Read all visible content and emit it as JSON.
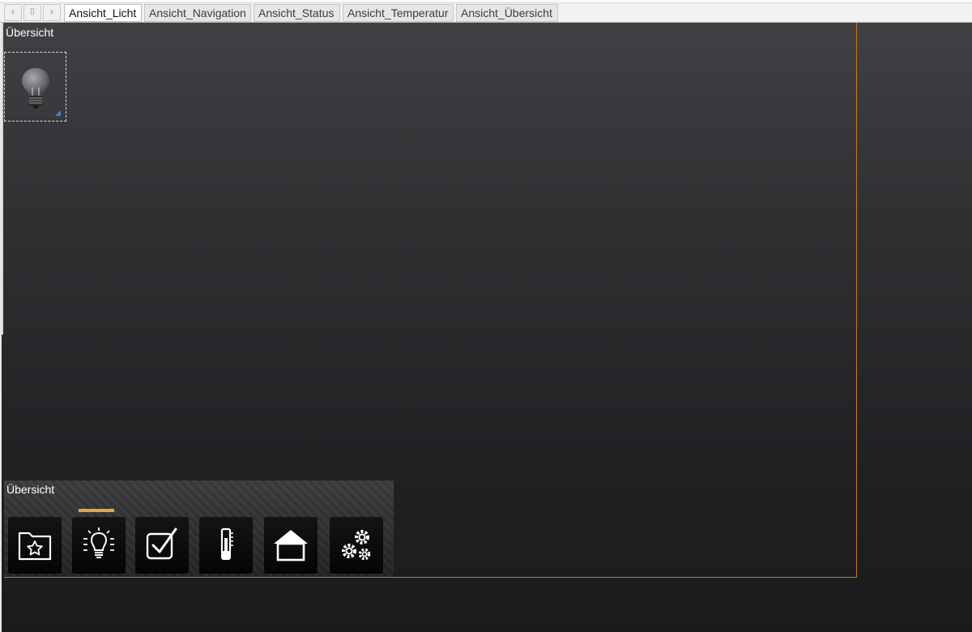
{
  "tabbar": {
    "nav_prev": "‹",
    "nav_menu": "⌷",
    "nav_next": "›",
    "tabs": [
      {
        "label": "Ansicht_Licht",
        "active": true
      },
      {
        "label": "Ansicht_Navigation",
        "active": false
      },
      {
        "label": "Ansicht_Status",
        "active": false
      },
      {
        "label": "Ansicht_Temperatur",
        "active": false
      },
      {
        "label": "Ansicht_Übersicht",
        "active": false
      }
    ]
  },
  "canvas": {
    "view_title": "Übersicht",
    "widget_icon": "light-bulb-icon"
  },
  "nav_widget": {
    "title": "Übersicht",
    "active_index": 1,
    "items": [
      {
        "icon": "folder-star-icon"
      },
      {
        "icon": "light-bulb-icon"
      },
      {
        "icon": "checkbox-icon"
      },
      {
        "icon": "thermometer-icon"
      },
      {
        "icon": "house-icon"
      },
      {
        "icon": "gears-icon"
      }
    ]
  },
  "colors": {
    "accent": "#e8a640",
    "frame": "#c67a12",
    "selection": "#4a7fc0"
  }
}
